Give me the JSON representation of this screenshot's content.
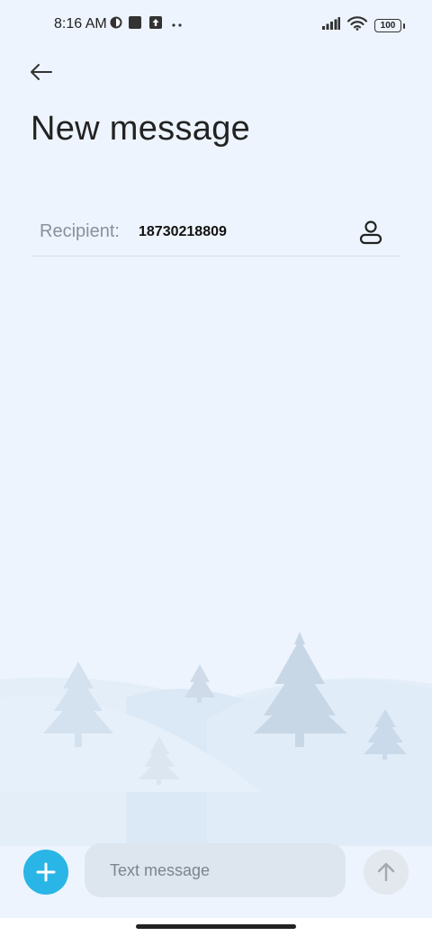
{
  "status_bar": {
    "time": "8:16 AM",
    "battery": "100",
    "icons": [
      "vpn-icon",
      "square-icon",
      "upload-icon",
      "more-dots-icon",
      "signal-icon",
      "wifi-icon",
      "battery-icon"
    ]
  },
  "header": {
    "title": "New message"
  },
  "recipient": {
    "label": "Recipient:",
    "value": "18730218809"
  },
  "composer": {
    "placeholder": "Text message"
  },
  "colors": {
    "accent": "#29b5e6",
    "background": "#edf4fd",
    "input_bg": "#dde5ef"
  }
}
